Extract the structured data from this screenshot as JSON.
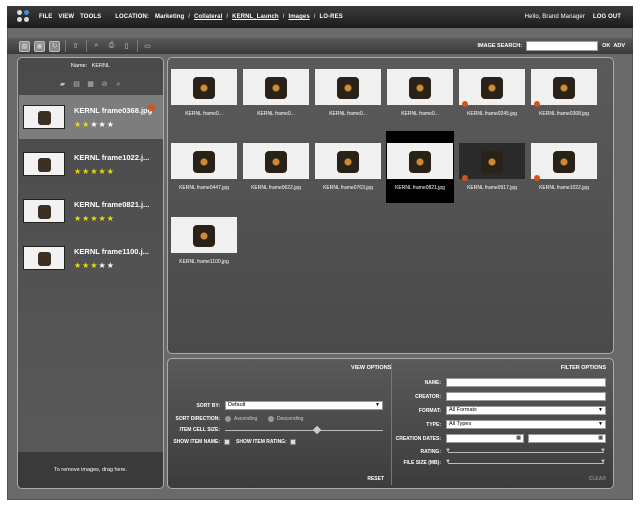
{
  "menu": {
    "file": "FILE",
    "view": "VIEW",
    "tools": "TOOLS"
  },
  "location": {
    "label": "LOCATION:",
    "crumbs": [
      "Marketing",
      "Collateral",
      "KERNL_Launch",
      "Images",
      "LO-RES"
    ],
    "separator": "/"
  },
  "user": {
    "greeting": "Hello, Brand Manager",
    "logout": "LOG OUT"
  },
  "search": {
    "label": "IMAGE SEARCH:",
    "go": "OK",
    "advanced": "ADV"
  },
  "lightbox": {
    "name_label": "Name:",
    "name_value": "KERNL",
    "drag_hint": "To remove images, drag here.",
    "items": [
      {
        "name": "KERNL frame0368.jpg",
        "rating": 2,
        "badge": true
      },
      {
        "name": "KERNL frame1022.j...",
        "rating": 5,
        "badge": false
      },
      {
        "name": "KERNL frame0821.j...",
        "rating": 5,
        "badge": false
      },
      {
        "name": "KERNL frame1100.j...",
        "rating": 3,
        "badge": false
      }
    ]
  },
  "grid": {
    "tiles": [
      {
        "caption": "KERNL frame0...",
        "badge": false,
        "dark": false
      },
      {
        "caption": "KERNL frame0...",
        "badge": false,
        "dark": false
      },
      {
        "caption": "KERNL frame0...",
        "badge": false,
        "dark": false
      },
      {
        "caption": "KERNL frame0...",
        "badge": false,
        "dark": false
      },
      {
        "caption": "KERNL frame0245.jpg",
        "badge": true,
        "dark": false
      },
      {
        "caption": "KERNL frame0368.jpg",
        "badge": true,
        "dark": false
      },
      {
        "caption": "KERNL frame0447.jpg",
        "badge": false,
        "dark": false
      },
      {
        "caption": "KERNL frame0622.jpg",
        "badge": false,
        "dark": false
      },
      {
        "caption": "KERNL frame0763.jpg",
        "badge": false,
        "dark": false
      },
      {
        "caption": "KERNL frame0821.jpg",
        "badge": false,
        "dark": false,
        "selected": true
      },
      {
        "caption": "KERNL frame0917.jpg",
        "badge": true,
        "dark": true
      },
      {
        "caption": "KERNL frame1022.jpg",
        "badge": true,
        "dark": false
      },
      {
        "caption": "KERNL frame1100.jpg",
        "badge": false,
        "dark": false
      }
    ]
  },
  "view_options": {
    "title": "VIEW OPTIONS",
    "sort_by_label": "SORT BY:",
    "sort_by_value": "Default",
    "sort_direction_label": "SORT DIRECTION:",
    "ascending": "Ascending",
    "descending": "Descending",
    "cell_size_label": "ITEM CELL SIZE:",
    "cell_size_level": 0.58,
    "show_name_label": "SHOW ITEM NAME:",
    "show_rating_label": "SHOW ITEM RATING:",
    "reset": "RESET"
  },
  "filter_options": {
    "title": "FILTER OPTIONS",
    "name_label": "NAME:",
    "creator_label": "CREATOR:",
    "format_label": "FORMAT:",
    "format_value": "All Formats",
    "type_label": "TYPE:",
    "type_value": "All Types",
    "dates_label": "CREATION DATES:",
    "rating_label": "RATING:",
    "filesize_label": "FILE SIZE (MB):",
    "clear": "CLEAR"
  }
}
